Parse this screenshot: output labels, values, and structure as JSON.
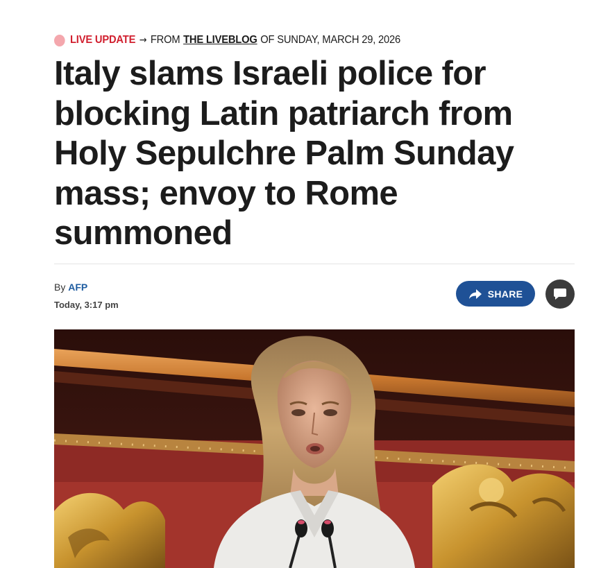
{
  "kicker": {
    "live_label": "LIVE UPDATE",
    "arrow": "→",
    "from_text": "FROM",
    "liveblog_link": "THE LIVEBLOG",
    "date_text": "OF SUNDAY, MARCH 29, 2026"
  },
  "article": {
    "headline": "Italy slams Israeli police for blocking Latin patriarch from Holy Sepulchre Palm Sunday mass; envoy to Rome summoned",
    "byline_prefix": "By",
    "author": "AFP",
    "timestamp": "Today, 3:17 pm"
  },
  "actions": {
    "share_label": "SHARE",
    "share_icon": "share-arrow-icon",
    "comment_icon": "comment-bubble-icon"
  },
  "colors": {
    "live_red": "#d1202f",
    "live_dot": "#f4a7ad",
    "share_blue": "#1f5196",
    "author_blue": "#1f5da1",
    "comment_dark": "#3b3b3b"
  }
}
